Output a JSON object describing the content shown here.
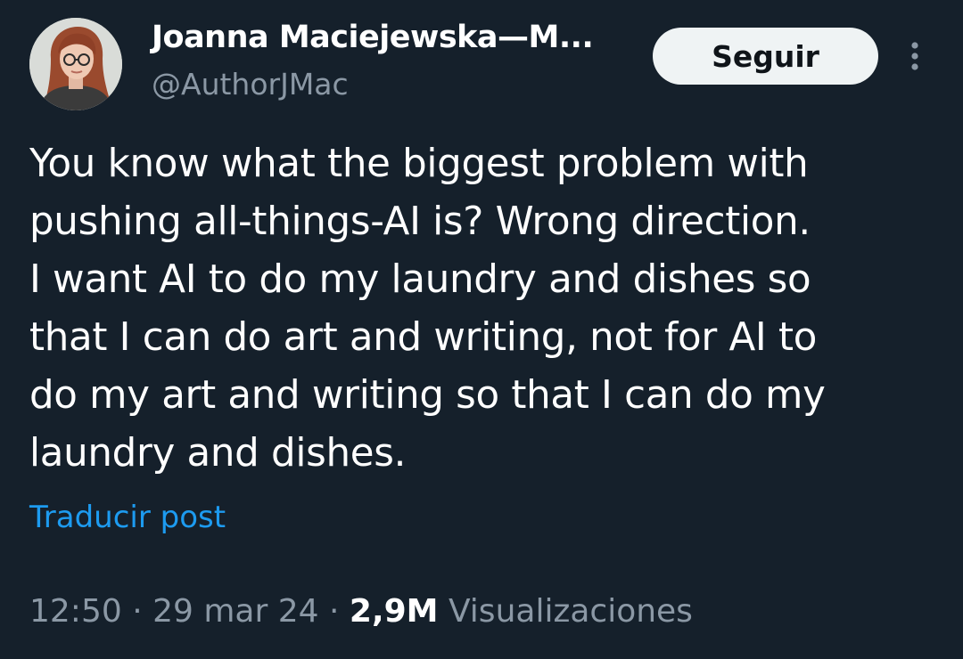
{
  "author": {
    "display_name": "Joanna Maciejewska—M...",
    "handle": "@AuthorJMac",
    "avatar_icon": "profile-photo"
  },
  "follow_button": {
    "label": "Seguir"
  },
  "more_menu": {
    "icon": "vertical-ellipsis-icon"
  },
  "post": {
    "lines": [
      "You know what the biggest problem with",
      "pushing all-things-AI is? Wrong direction.",
      "I want AI to do my laundry and dishes so",
      "that I can do art and writing, not for AI to",
      "do my art and writing so that I can do my",
      "laundry and dishes."
    ]
  },
  "translate": {
    "label": "Traducir post"
  },
  "meta": {
    "time": "12:50",
    "separator": "·",
    "date": "29 mar 24",
    "views_count": "2,9M",
    "views_label": "Visualizaciones"
  },
  "colors": {
    "background": "#15202b",
    "text": "#ffffff",
    "secondary_text": "#8b98a5",
    "link": "#1d9bf0",
    "button_bg": "#eff3f4",
    "button_text": "#0f1419"
  }
}
